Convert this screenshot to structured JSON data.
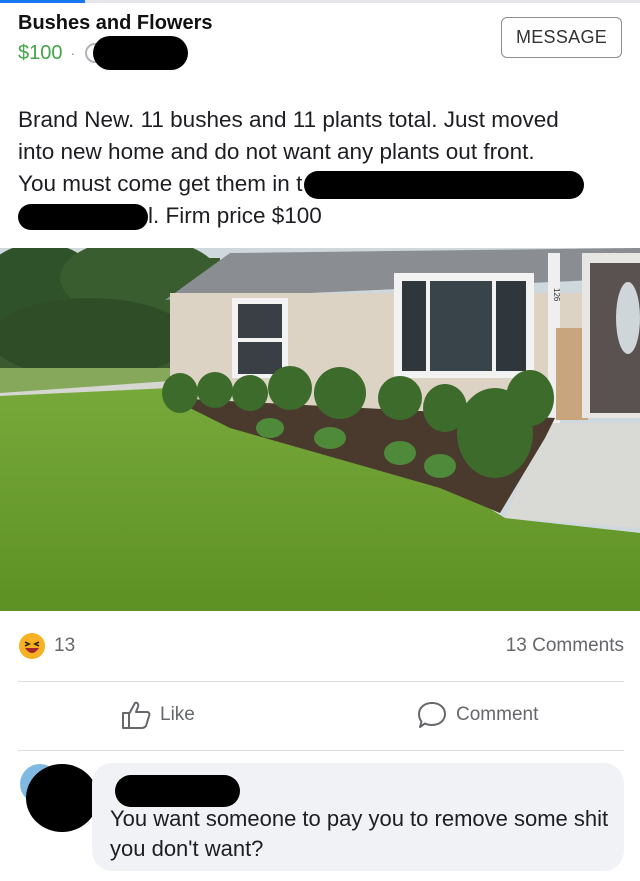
{
  "listing": {
    "title": "Bushes and Flowers",
    "price": "$100",
    "separator": "·",
    "message_button": "MESSAGE"
  },
  "description": {
    "line1": "Brand New. 11 bushes and 11 plants total. Just moved",
    "line2": "into new home and do not want any plants out front.",
    "line3": "You must come get them in t",
    "line4": "l. Firm price $100"
  },
  "photo": {
    "house_number": "126"
  },
  "engagement": {
    "reaction_icon": "laughing-emoji-icon",
    "reaction_count": "13",
    "comments_count": "13 Comments",
    "like_label": "Like",
    "comment_label": "Comment"
  },
  "comment": {
    "text": "You want someone to pay you to remove some shit you don't want?"
  },
  "colors": {
    "price": "#42a548",
    "secondary_text": "#65676b",
    "comment_bg": "#f0f2f5"
  }
}
